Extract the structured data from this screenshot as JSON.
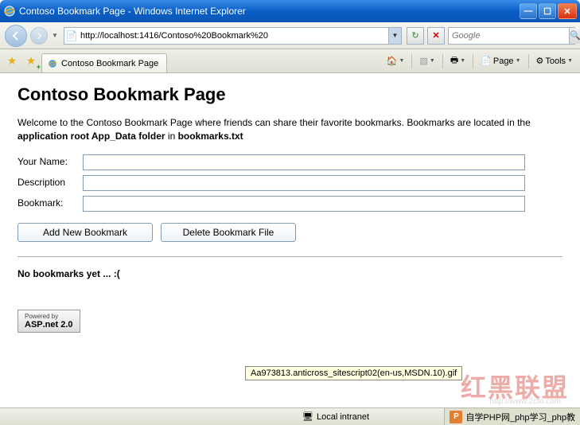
{
  "window": {
    "title": "Contoso Bookmark Page - Windows Internet Explorer"
  },
  "nav": {
    "url": "http://localhost:1416/Contoso%20Bookmark%20",
    "search_placeholder": "Google"
  },
  "tab": {
    "title": "Contoso Bookmark Page"
  },
  "toolbar": {
    "page_label": "Page",
    "tools_label": "Tools"
  },
  "page": {
    "heading": "Contoso Bookmark Page",
    "intro_before": "Welcome to the Contoso Bookmark Page where friends can share their favorite bookmarks. Bookmarks are located in the ",
    "intro_bold1": "application root App_Data folder",
    "intro_mid": " in ",
    "intro_bold2": "bookmarks.txt",
    "name_label": "Your Name:",
    "desc_label": "Description",
    "bookmark_label": "Bookmark:",
    "name_value": "",
    "desc_value": "",
    "bookmark_value": "",
    "add_btn": "Add New Bookmark",
    "delete_btn": "Delete Bookmark File",
    "no_bookmarks": "No bookmarks yet ... :("
  },
  "badge": {
    "powered": "Powered by",
    "asp": "ASP.net 2.0"
  },
  "tooltip": "Aa973813.anticross_sitescript02(en-us,MSDN.10).gif",
  "status": {
    "zone": "Local intranet",
    "watermark_cn": "红黑联盟",
    "watermark_url": "http://www.2cto.com",
    "php_badge": "自学PHP网_php学习_php教"
  }
}
